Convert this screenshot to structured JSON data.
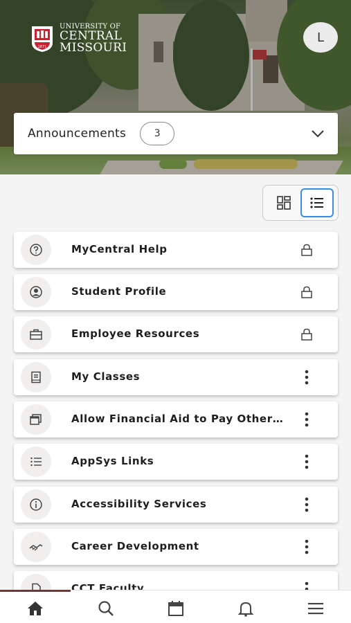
{
  "header": {
    "logo": {
      "line1": "UNIVERSITY OF",
      "line2": "CENTRAL",
      "line3": "MISSOURI",
      "seal_text": "1871"
    },
    "avatar_initial": "L"
  },
  "announcements": {
    "title": "Announcements",
    "count": "3"
  },
  "view_toggle": {
    "active": "list"
  },
  "cards": [
    {
      "label": "MyCentral Help",
      "icon": "question-circle-icon",
      "action": "lock-icon"
    },
    {
      "label": "Student Profile",
      "icon": "user-circle-icon",
      "action": "lock-icon"
    },
    {
      "label": "Employee Resources",
      "icon": "briefcase-icon",
      "action": "lock-icon"
    },
    {
      "label": "My Classes",
      "icon": "book-icon",
      "action": "more-vertical-icon"
    },
    {
      "label": "Allow Financial Aid to Pay Other Charges",
      "icon": "windows-icon",
      "action": "more-vertical-icon"
    },
    {
      "label": "AppSys Links",
      "icon": "list-icon",
      "action": "more-vertical-icon"
    },
    {
      "label": "Accessibility Services",
      "icon": "info-circle-icon",
      "action": "more-vertical-icon"
    },
    {
      "label": "Career Development",
      "icon": "handshake-icon",
      "action": "more-vertical-icon"
    },
    {
      "label": "CCT Faculty",
      "icon": "document-icon",
      "action": "more-vertical-icon"
    }
  ],
  "bottom_nav": [
    "home-icon",
    "search-icon",
    "calendar-icon",
    "bell-icon",
    "menu-icon"
  ],
  "colors": {
    "brand_red": "#cc1f2f",
    "active_blue": "#3c8ad8",
    "indicator": "#6b3a3a"
  }
}
